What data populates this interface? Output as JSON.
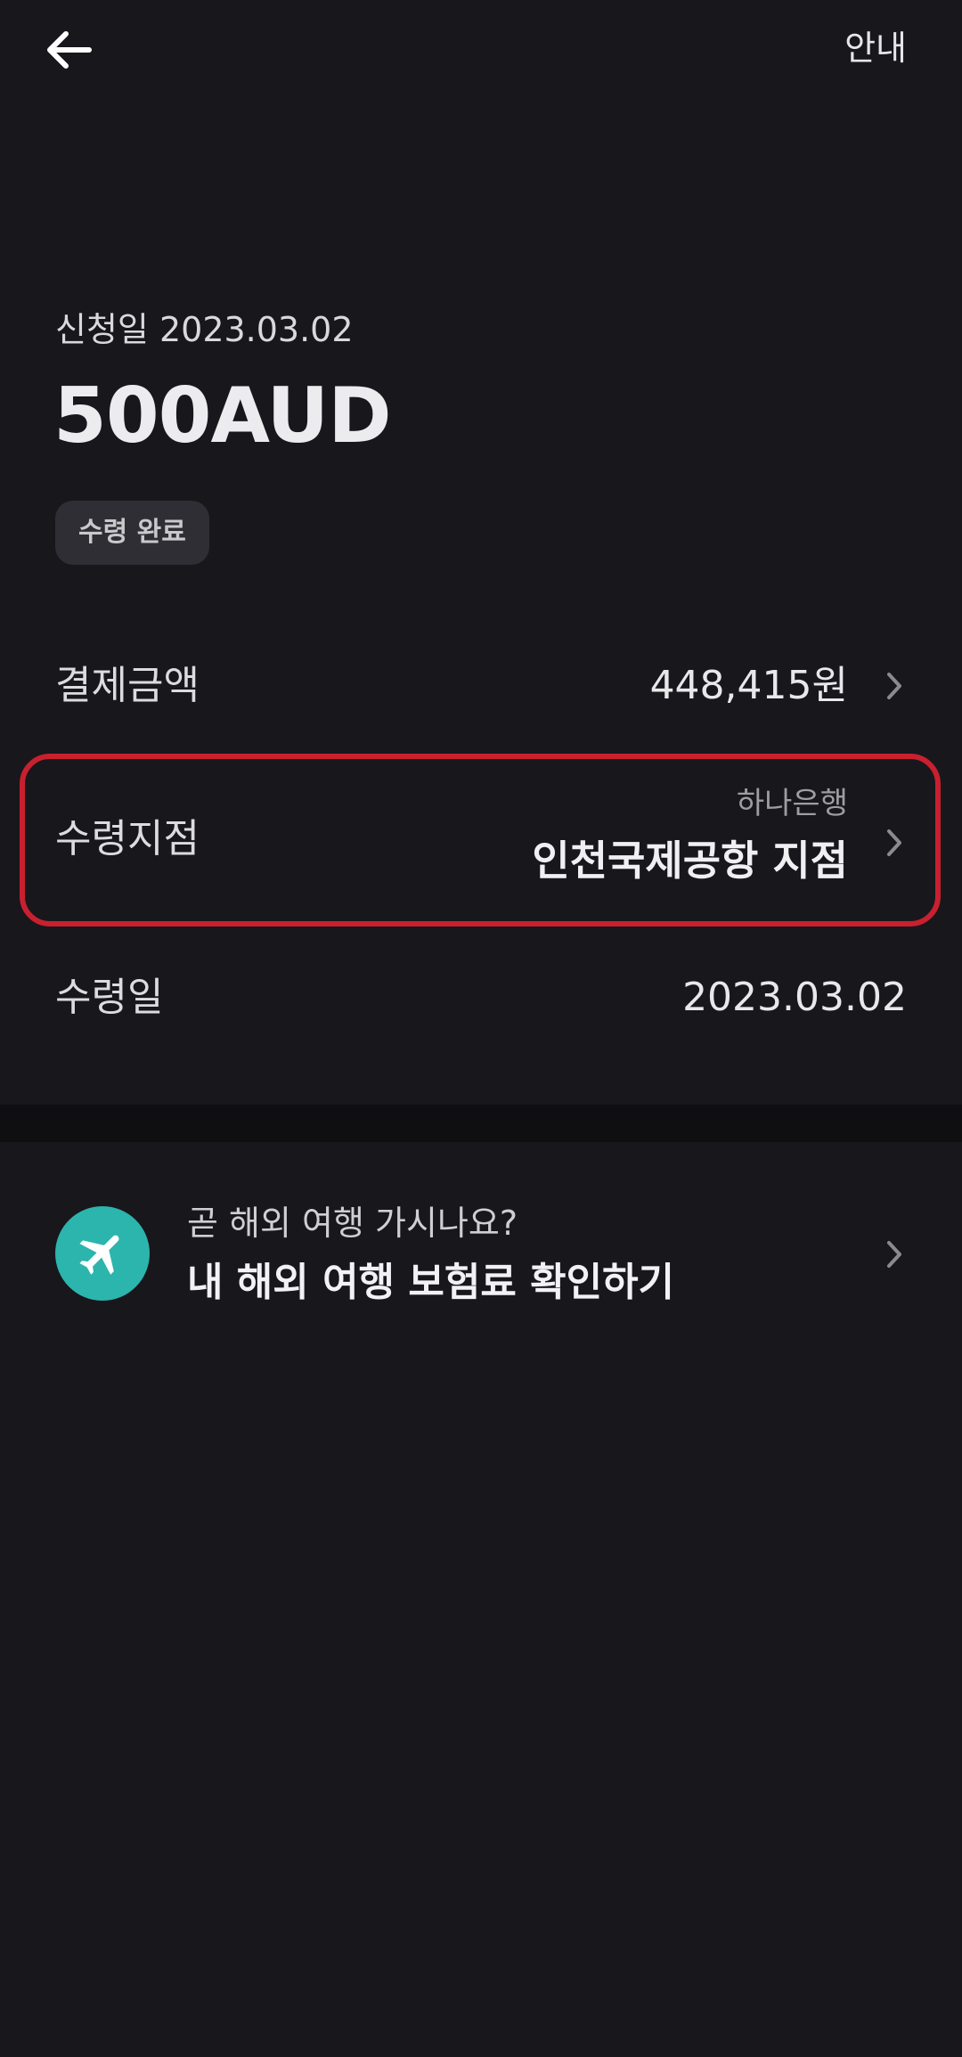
{
  "header": {
    "back_icon": "arrow-left-icon",
    "info_label": "안내"
  },
  "summary": {
    "apply_date": "신청일 2023.03.02",
    "amount": "500AUD",
    "status": "수령 완료"
  },
  "rows": {
    "payment": {
      "label": "결제금액",
      "value": "448,415원"
    },
    "branch": {
      "label": "수령지점",
      "bank": "하나은행",
      "branch": "인천국제공항 지점"
    },
    "receive_date": {
      "label": "수령일",
      "value": "2023.03.02"
    }
  },
  "promo": {
    "icon": "airplane-icon",
    "subtitle": "곧 해외 여행 가시나요?",
    "title": "내 해외 여행 보험료 확인하기"
  },
  "colors": {
    "background": "#18171c",
    "highlight": "#c8202f",
    "promo_icon_bg": "#2bb5ad",
    "badge_bg": "#2f2e34"
  }
}
